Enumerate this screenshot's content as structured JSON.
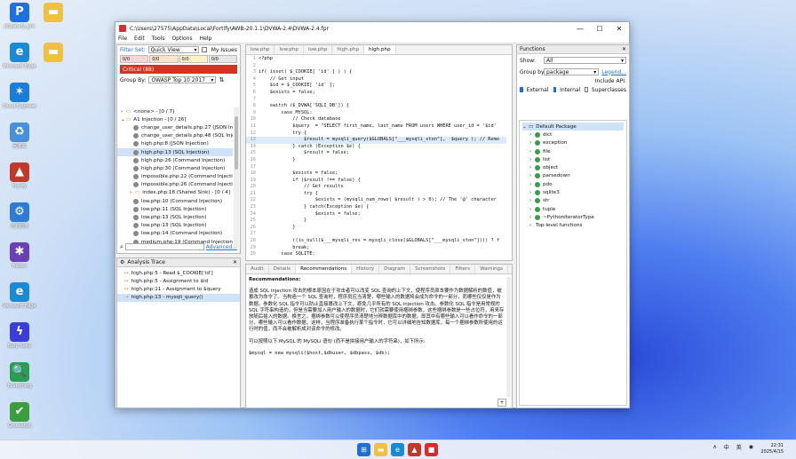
{
  "desktop": [
    {
      "label": "phpstudy_pro",
      "color": "#1e6fe0",
      "glyph": "P"
    },
    {
      "label": "",
      "color": "#f0c040",
      "glyph": "▬"
    },
    {
      "label": "Microsoft Edge",
      "color": "#1a8ad4",
      "glyph": "e"
    },
    {
      "label": "",
      "color": "#f0c040",
      "glyph": "▬"
    },
    {
      "label": "Cloud Engineer",
      "color": "#1a7ed8",
      "glyph": "✶"
    },
    {
      "label": "回收站",
      "color": "#4a90d9",
      "glyph": "♻"
    },
    {
      "label": "Fortify",
      "color": "#c0392b",
      "glyph": "▲"
    },
    {
      "label": "控制面板",
      "color": "#2e7bd6",
      "glyph": "⚙"
    },
    {
      "label": "Fiddler",
      "color": "#6a3fb8",
      "glyph": "✱"
    },
    {
      "label": "Microsoft Edge",
      "color": "#1a8ad4",
      "glyph": "e"
    },
    {
      "label": "Burp Suite",
      "color": "#3b3ddb",
      "glyph": "ϟ"
    },
    {
      "label": "Everything",
      "color": "#2a9d54",
      "glyph": "🔍"
    },
    {
      "label": "Greenshot",
      "color": "#3c9d3c",
      "glyph": "✔"
    }
  ],
  "window": {
    "title": "C:\\Users\\27575\\AppData\\Local\\Fortify\\AWB-20.1.1\\DVWA-2.4\\DVWA-2.4.fpr",
    "menu": [
      "File",
      "Edit",
      "Tools",
      "Options",
      "Help"
    ]
  },
  "issues": {
    "filter_label": "Filter Set:",
    "filter_value": "Quick View",
    "my_issues": "My Issues",
    "sev_counts": [
      "0/0",
      "0/0",
      "0/0",
      "0/0"
    ],
    "critical": "Critical (88)",
    "group_label": "Group By:",
    "group_value": "OWASP Top 10 2017",
    "tree": [
      {
        "t": "<none> - [0 / 7]",
        "indent": 4
      },
      {
        "t": "A1 Injection - [0 / 26]",
        "indent": 4
      },
      {
        "t": "change_user_details.php:27 (JSON Inje",
        "indent": 18
      },
      {
        "t": "change_user_details.php:48 (SQL Inject",
        "indent": 18
      },
      {
        "t": "high.php:8 (JSON Injection)",
        "indent": 18
      },
      {
        "t": "high.php:13 (SQL Injection)",
        "indent": 18
      },
      {
        "t": "high.php:26 (Command Injection)",
        "indent": 18
      },
      {
        "t": "high.php:30 (Command Injection)",
        "indent": 18
      },
      {
        "t": "impossible.php:22 (Command Injection",
        "indent": 18
      },
      {
        "t": "impossible.php:26 (Command Injection",
        "indent": 18
      },
      {
        "t": "index.php:18 (Shared Sink) - [0 / 4]",
        "indent": 14
      },
      {
        "t": "low.php:10 (Command Injection)",
        "indent": 18
      },
      {
        "t": "low.php:11 (SQL Injection)",
        "indent": 18
      },
      {
        "t": "low.php:13 (SQL Injection)",
        "indent": 18
      },
      {
        "t": "low.php:13 (SQL Injection)",
        "indent": 18
      },
      {
        "t": "low.php:14 (Command Injection)",
        "indent": 18
      },
      {
        "t": "medium.php:19 (Command Injection)",
        "indent": 18
      }
    ],
    "selected_index": 5,
    "advanced": "Advanced..."
  },
  "trace": {
    "title": "Analysis Trace",
    "items": [
      "high.php:5 - Read $_COOKIE['id']",
      "high.php:5 - Assignment to $id",
      "high.php:11 - Assignment to $query",
      "high.php:13 - mysqli_query()"
    ]
  },
  "editor": {
    "tabs": [
      "low.php",
      "low.php",
      "low.php",
      "high.php",
      "high.php"
    ],
    "active_tab": 4,
    "lines": [
      [
        "1",
        "<?php"
      ],
      [
        "2",
        ""
      ],
      [
        "3",
        "if( isset( $_COOKIE[ 'id' ] ) ) {"
      ],
      [
        "4",
        "    // Get input"
      ],
      [
        "5",
        "    $id = $_COOKIE[ 'id' ];"
      ],
      [
        "6",
        "    $exists = false;"
      ],
      [
        "7",
        ""
      ],
      [
        "8",
        "    switch ($_DVWA['SQLI_DB']) {"
      ],
      [
        "9",
        "        case MYSQL:"
      ],
      [
        "10",
        "            // Check database"
      ],
      [
        "11",
        "            $query  = \"SELECT first_name, last_name FROM users WHERE user_id = '$id'"
      ],
      [
        "12",
        "            try {"
      ],
      [
        "13",
        "                $result = mysqli_query($GLOBALS[\"___mysqli_ston\"],  $query ); // Remo"
      ],
      [
        "14",
        "            } catch (Exception $e) {"
      ],
      [
        "15",
        "                $result = false;"
      ],
      [
        "16",
        "            }"
      ],
      [
        "17",
        ""
      ],
      [
        "18",
        "            $exists = false;"
      ],
      [
        "19",
        "            if ($result !== false) {"
      ],
      [
        "20",
        "                // Get results"
      ],
      [
        "21",
        "                try {"
      ],
      [
        "22",
        "                    $exists = (mysqli_num_rows( $result ) > 0); // The '@' character"
      ],
      [
        "23",
        "                } catch(Exception $e) {"
      ],
      [
        "24",
        "                    $exists = false;"
      ],
      [
        "25",
        "                }"
      ],
      [
        "26",
        "            }"
      ],
      [
        "27",
        ""
      ],
      [
        "28",
        "            ((is_null($___mysqli_res = mysqli_close($GLOBALS[\"___mysqli_ston\"]))) ? f"
      ],
      [
        "29",
        "            break;"
      ],
      [
        "30",
        "        case SQLITE:"
      ],
      [
        "31",
        "            global $sqlite_db_connection;"
      ],
      [
        "32",
        ""
      ],
      [
        "33",
        "            $query  = \"SELECT first_name, last_name FROM users WHERE user_id = '$id'"
      ]
    ],
    "highlight_line": 12
  },
  "bottom": {
    "tabs": [
      "Audit",
      "Details",
      "Recommendations",
      "History",
      "Diagram",
      "Screenshots",
      "Filters",
      "Warnings"
    ],
    "active_tab": 2,
    "heading": "Recommendations:",
    "para1": "造成 SQL injection 攻击的根本原因在于攻击者可以改变 SQL 查询的上下文，使程序员原本要作为数据解析的数值，被篡改为命令了。当构造一个 SQL 查询时，程序员应当清楚，哪些输入的数据将会成为命令的一部分，而哪些仅仅是作为数据。参数化 SQL 指令可以防止直接篡改上下文，避免几乎所有的 SQL injection 攻击。参数化 SQL 指令是用常规的 SQL 字符串构造的，但是当需要加入用户输入的数据时，它们就需要使用捆绑参数，这些捆绑参数是一些占位符，用来存放随后插入的数据。换言之，捆绑参数可以使程序员清楚地分辨数据库中的数据，即其中有哪些输入可以看作命令的一部分，哪些输入可以看作数据。这样，当程序准备执行某个指令时，它可以详细地告知数据库，每一个捆绑参数所使用的运行时的值，而不会被解析成对该命令的修改。",
    "para2": "可以按照以下 MySQL 的 MySQLi 语句 (而不是拼接用户输入的字符串)，如下所示:",
    "code": "$mysql = new mysqli($host,$dbuser, $dbpass, $db);"
  },
  "functions": {
    "title": "Functions",
    "show_label": "Show:",
    "show_value": "All",
    "group_label": "Group by:",
    "group_value": "package",
    "legend": "Legend...",
    "include_api": "Include API:",
    "external": "External",
    "internal": "Internal",
    "superclasses": "Superclasses",
    "root": "Default Package",
    "items": [
      "dict",
      "exception",
      "file",
      "list",
      "object",
      "parsedown",
      "pdo",
      "sqlite3",
      "str",
      "tuple",
      "~PythonIteratorType"
    ],
    "top_level": "Top-level functions"
  },
  "taskbar": {
    "tray_chars": [
      "∧",
      "中",
      "英",
      "◉"
    ],
    "time": "22:31",
    "date": "2025/4/15"
  }
}
